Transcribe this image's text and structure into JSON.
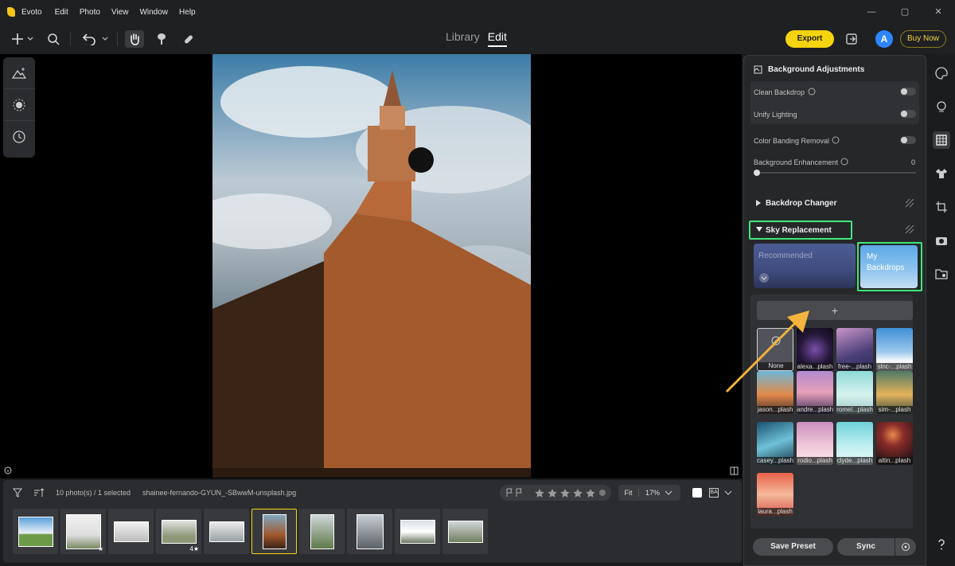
{
  "app": {
    "name": "Evoto"
  },
  "menu": [
    "Edit",
    "Photo",
    "View",
    "Window",
    "Help"
  ],
  "window_controls": [
    "—",
    "▢",
    "✕"
  ],
  "mode_tabs": {
    "library": "Library",
    "edit": "Edit"
  },
  "toolbar": {
    "export": "Export",
    "avatar_letter": "A",
    "buy_now": "Buy Now"
  },
  "panel": {
    "background_adjustments": "Background Adjustments",
    "clean_backdrop": "Clean Backdrop",
    "unify_lighting": "Unify Lighting",
    "color_banding_removal": "Color Banding Removal",
    "background_enhancement": "Background Enhancement",
    "background_enhancement_value": "0",
    "backdrop_changer": "Backdrop Changer",
    "sky_replacement": "Sky Replacement",
    "recommended": "Recommended",
    "my_backdrops": "My Backdrops",
    "add": "+",
    "save_preset": "Save Preset",
    "sync": "Sync"
  },
  "sky_tiles": [
    "None",
    "alexa...plash",
    "free-...plash",
    "slnc-...plash",
    "jason...plash",
    "andre...plash",
    "romel...plash",
    "sim-...plash",
    "casey...plash",
    "rodio...plash",
    "clyde...plash",
    "altin...plash",
    "laura...plash"
  ],
  "filmstrip": {
    "count": "10 photo(s) / 1 selected",
    "filename": "shainee-fernando-GYUN_-SBwwM-unsplash.jpg",
    "fit": "Fit",
    "zoom": "17%",
    "thumb_badges": [
      "★",
      "4★"
    ]
  }
}
